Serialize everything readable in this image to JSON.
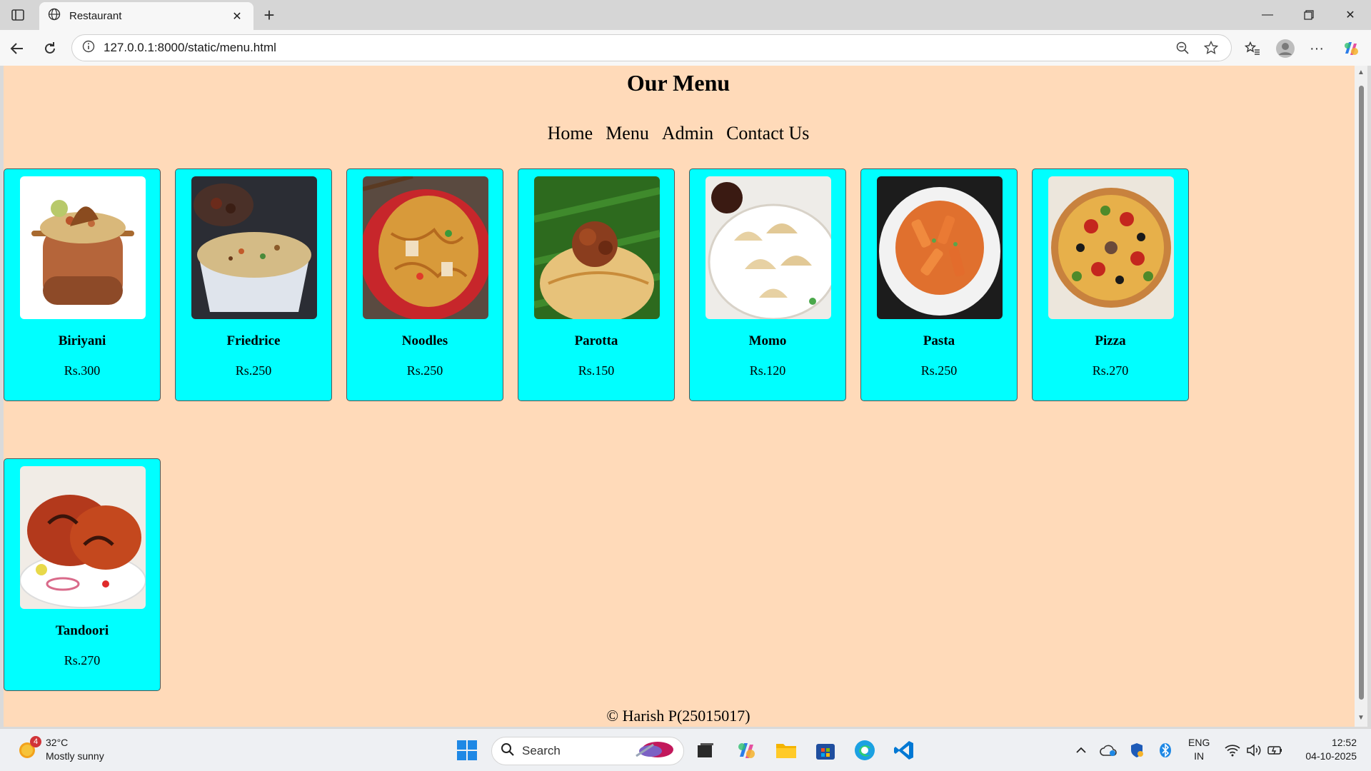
{
  "browser": {
    "tab_title": "Restaurant",
    "url": "127.0.0.1:8000/static/menu.html"
  },
  "page": {
    "title": "Our Menu",
    "nav": [
      "Home",
      "Menu",
      "Admin",
      "Contact Us"
    ],
    "background_color": "#ffdab9",
    "card_color": "#00ffff",
    "items": [
      {
        "name": "Biriyani",
        "price": "Rs.300",
        "image": "biriyani-pot"
      },
      {
        "name": "Friedrice",
        "price": "Rs.250",
        "image": "fried-rice-bowl"
      },
      {
        "name": "Noodles",
        "price": "Rs.250",
        "image": "noodles-plate"
      },
      {
        "name": "Parotta",
        "price": "Rs.150",
        "image": "parotta-leaf"
      },
      {
        "name": "Momo",
        "price": "Rs.120",
        "image": "momo-plate"
      },
      {
        "name": "Pasta",
        "price": "Rs.250",
        "image": "pasta-bowl"
      },
      {
        "name": "Pizza",
        "price": "Rs.270",
        "image": "pizza"
      },
      {
        "name": "Tandoori",
        "price": "Rs.270",
        "image": "tandoori-chicken"
      }
    ],
    "footer": "© Harish P(25015017)"
  },
  "taskbar": {
    "weather_badge": "4",
    "temperature": "32°C",
    "weather_desc": "Mostly sunny",
    "search_label": "Search",
    "lang_line1": "ENG",
    "lang_line2": "IN",
    "time": "12:52",
    "date": "04-10-2025"
  }
}
